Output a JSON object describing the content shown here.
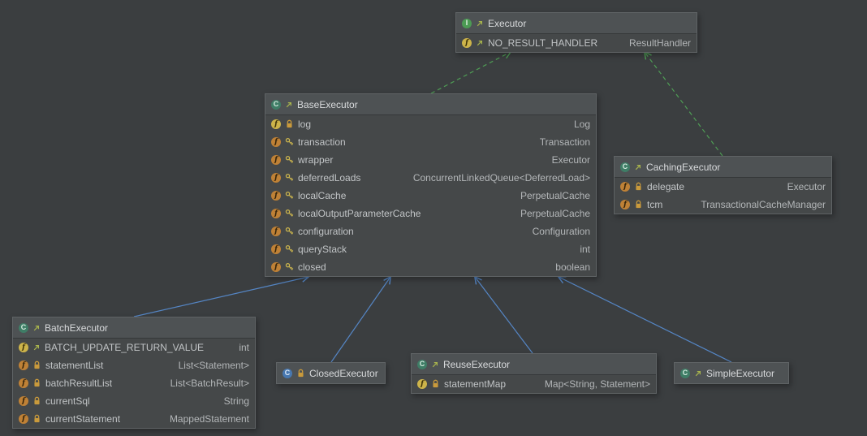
{
  "diagram": {
    "colors": {
      "background": "#3B3E40",
      "node_background": "#454849",
      "node_header": "#4E5254",
      "extends_edge": "#5586C5",
      "implements_edge": "#4F9E55",
      "field_icon": "#BF8136",
      "static_field_icon": "#CDB44A"
    },
    "nodes": {
      "executor": {
        "kind": "interface",
        "title": "Executor",
        "fields": [
          {
            "name": "NO_RESULT_HANDLER",
            "type": "ResultHandler",
            "icons": [
              "static-field-icon",
              "static-marker-icon"
            ]
          }
        ]
      },
      "baseExecutor": {
        "kind": "class",
        "title": "BaseExecutor",
        "fields": [
          {
            "name": "log",
            "type": "Log",
            "icons": [
              "static-field-icon",
              "lock-icon"
            ]
          },
          {
            "name": "transaction",
            "type": "Transaction",
            "icons": [
              "field-icon",
              "key-icon"
            ]
          },
          {
            "name": "wrapper",
            "type": "Executor",
            "icons": [
              "field-icon",
              "key-icon"
            ]
          },
          {
            "name": "deferredLoads",
            "type": "ConcurrentLinkedQueue<DeferredLoad>",
            "icons": [
              "field-icon",
              "key-icon"
            ]
          },
          {
            "name": "localCache",
            "type": "PerpetualCache",
            "icons": [
              "field-icon",
              "key-icon"
            ]
          },
          {
            "name": "localOutputParameterCache",
            "type": "PerpetualCache",
            "icons": [
              "field-icon",
              "key-icon"
            ]
          },
          {
            "name": "configuration",
            "type": "Configuration",
            "icons": [
              "field-icon",
              "key-icon"
            ]
          },
          {
            "name": "queryStack",
            "type": "int",
            "icons": [
              "field-icon",
              "key-icon"
            ]
          },
          {
            "name": "closed",
            "type": "boolean",
            "icons": [
              "field-icon",
              "key-icon"
            ]
          }
        ]
      },
      "cachingExecutor": {
        "kind": "class",
        "title": "CachingExecutor",
        "fields": [
          {
            "name": "delegate",
            "type": "Executor",
            "icons": [
              "field-icon",
              "lock-icon"
            ]
          },
          {
            "name": "tcm",
            "type": "TransactionalCacheManager",
            "icons": [
              "field-icon",
              "lock-icon"
            ]
          }
        ]
      },
      "batchExecutor": {
        "kind": "class",
        "title": "BatchExecutor",
        "fields": [
          {
            "name": "BATCH_UPDATE_RETURN_VALUE",
            "type": "int",
            "icons": [
              "static-field-icon",
              "static-marker-icon"
            ]
          },
          {
            "name": "statementList",
            "type": "List<Statement>",
            "icons": [
              "field-icon",
              "lock-icon"
            ]
          },
          {
            "name": "batchResultList",
            "type": "List<BatchResult>",
            "icons": [
              "field-icon",
              "lock-icon"
            ]
          },
          {
            "name": "currentSql",
            "type": "String",
            "icons": [
              "field-icon",
              "lock-icon"
            ]
          },
          {
            "name": "currentStatement",
            "type": "MappedStatement",
            "icons": [
              "field-icon",
              "lock-icon"
            ]
          }
        ]
      },
      "closedExecutor": {
        "kind": "inner-class",
        "title": "ClosedExecutor",
        "fields": []
      },
      "reuseExecutor": {
        "kind": "class",
        "title": "ReuseExecutor",
        "fields": [
          {
            "name": "statementMap",
            "type": "Map<String, Statement>",
            "icons": [
              "static-field-icon",
              "lock-icon"
            ]
          }
        ]
      },
      "simpleExecutor": {
        "kind": "class",
        "title": "SimpleExecutor",
        "fields": []
      }
    },
    "edges": [
      {
        "from": "BaseExecutor",
        "to": "Executor",
        "relation": "implements"
      },
      {
        "from": "CachingExecutor",
        "to": "Executor",
        "relation": "implements"
      },
      {
        "from": "BatchExecutor",
        "to": "BaseExecutor",
        "relation": "extends"
      },
      {
        "from": "ClosedExecutor",
        "to": "BaseExecutor",
        "relation": "extends"
      },
      {
        "from": "ReuseExecutor",
        "to": "BaseExecutor",
        "relation": "extends"
      },
      {
        "from": "SimpleExecutor",
        "to": "BaseExecutor",
        "relation": "extends"
      }
    ]
  }
}
